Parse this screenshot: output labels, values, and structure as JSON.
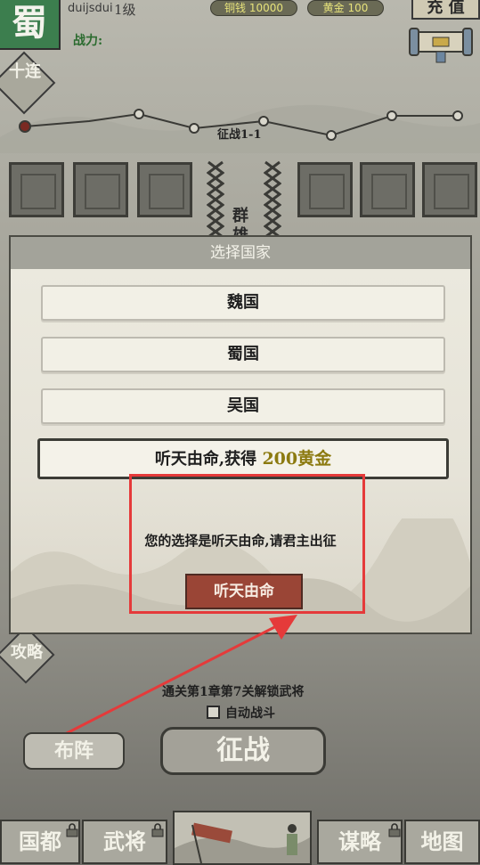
{
  "top_bar": {
    "nation": "蜀",
    "username": "duijsdui",
    "level": "1级",
    "copper": "铜钱 10000",
    "gold": "黄金 100",
    "recharge": "充 值",
    "power_label": "战力:"
  },
  "side": {
    "ten_draw": "十连",
    "strategy": "攻略"
  },
  "stage": {
    "label": "征战1-1"
  },
  "enemy_side": "群雄",
  "modal": {
    "title": "选择国家",
    "options": [
      {
        "label": "魏国"
      },
      {
        "label": "蜀国"
      },
      {
        "label": "吴国"
      }
    ],
    "fate_option": {
      "label": "听天由命,获得",
      "reward": "200黄金"
    },
    "choice_message": "您的选择是听天由命,请君主出征",
    "confirm_button": "听天由命"
  },
  "bottom": {
    "unlock_tip": "通关第1章第7关解锁武将",
    "auto_battle": "自动战斗",
    "auto_battle_checked": false,
    "formation_button": "布阵",
    "battle_button": "征战"
  },
  "nav": {
    "items": [
      {
        "label": "国都",
        "locked": true
      },
      {
        "label": "武将",
        "locked": true
      },
      {
        "label": "谋略",
        "locked": true
      },
      {
        "label": "地图",
        "locked": false
      }
    ]
  },
  "annotation": {
    "color": "#e53a3a"
  }
}
